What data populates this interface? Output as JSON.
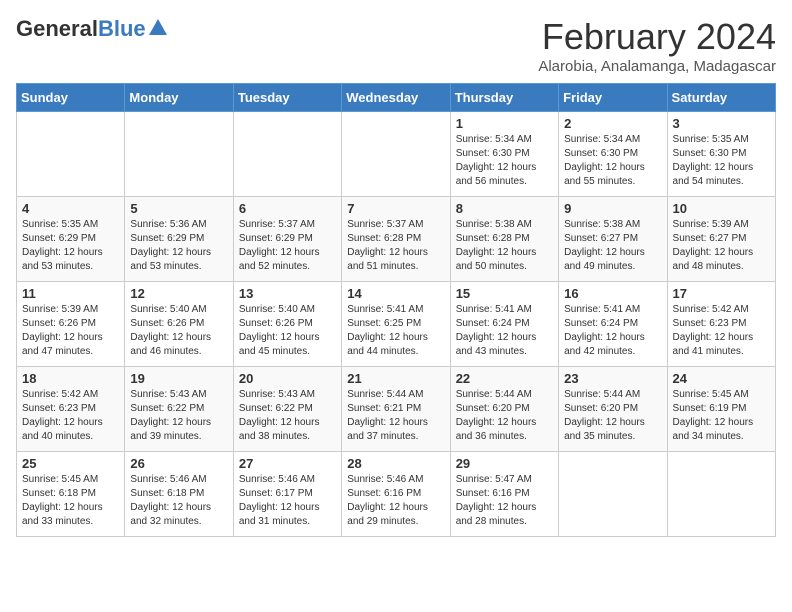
{
  "header": {
    "logo_general": "General",
    "logo_blue": "Blue",
    "month_title": "February 2024",
    "location": "Alarobia, Analamanga, Madagascar"
  },
  "weekdays": [
    "Sunday",
    "Monday",
    "Tuesday",
    "Wednesday",
    "Thursday",
    "Friday",
    "Saturday"
  ],
  "weeks": [
    [
      {
        "num": "",
        "info": ""
      },
      {
        "num": "",
        "info": ""
      },
      {
        "num": "",
        "info": ""
      },
      {
        "num": "",
        "info": ""
      },
      {
        "num": "1",
        "info": "Sunrise: 5:34 AM\nSunset: 6:30 PM\nDaylight: 12 hours\nand 56 minutes."
      },
      {
        "num": "2",
        "info": "Sunrise: 5:34 AM\nSunset: 6:30 PM\nDaylight: 12 hours\nand 55 minutes."
      },
      {
        "num": "3",
        "info": "Sunrise: 5:35 AM\nSunset: 6:30 PM\nDaylight: 12 hours\nand 54 minutes."
      }
    ],
    [
      {
        "num": "4",
        "info": "Sunrise: 5:35 AM\nSunset: 6:29 PM\nDaylight: 12 hours\nand 53 minutes."
      },
      {
        "num": "5",
        "info": "Sunrise: 5:36 AM\nSunset: 6:29 PM\nDaylight: 12 hours\nand 53 minutes."
      },
      {
        "num": "6",
        "info": "Sunrise: 5:37 AM\nSunset: 6:29 PM\nDaylight: 12 hours\nand 52 minutes."
      },
      {
        "num": "7",
        "info": "Sunrise: 5:37 AM\nSunset: 6:28 PM\nDaylight: 12 hours\nand 51 minutes."
      },
      {
        "num": "8",
        "info": "Sunrise: 5:38 AM\nSunset: 6:28 PM\nDaylight: 12 hours\nand 50 minutes."
      },
      {
        "num": "9",
        "info": "Sunrise: 5:38 AM\nSunset: 6:27 PM\nDaylight: 12 hours\nand 49 minutes."
      },
      {
        "num": "10",
        "info": "Sunrise: 5:39 AM\nSunset: 6:27 PM\nDaylight: 12 hours\nand 48 minutes."
      }
    ],
    [
      {
        "num": "11",
        "info": "Sunrise: 5:39 AM\nSunset: 6:26 PM\nDaylight: 12 hours\nand 47 minutes."
      },
      {
        "num": "12",
        "info": "Sunrise: 5:40 AM\nSunset: 6:26 PM\nDaylight: 12 hours\nand 46 minutes."
      },
      {
        "num": "13",
        "info": "Sunrise: 5:40 AM\nSunset: 6:26 PM\nDaylight: 12 hours\nand 45 minutes."
      },
      {
        "num": "14",
        "info": "Sunrise: 5:41 AM\nSunset: 6:25 PM\nDaylight: 12 hours\nand 44 minutes."
      },
      {
        "num": "15",
        "info": "Sunrise: 5:41 AM\nSunset: 6:24 PM\nDaylight: 12 hours\nand 43 minutes."
      },
      {
        "num": "16",
        "info": "Sunrise: 5:41 AM\nSunset: 6:24 PM\nDaylight: 12 hours\nand 42 minutes."
      },
      {
        "num": "17",
        "info": "Sunrise: 5:42 AM\nSunset: 6:23 PM\nDaylight: 12 hours\nand 41 minutes."
      }
    ],
    [
      {
        "num": "18",
        "info": "Sunrise: 5:42 AM\nSunset: 6:23 PM\nDaylight: 12 hours\nand 40 minutes."
      },
      {
        "num": "19",
        "info": "Sunrise: 5:43 AM\nSunset: 6:22 PM\nDaylight: 12 hours\nand 39 minutes."
      },
      {
        "num": "20",
        "info": "Sunrise: 5:43 AM\nSunset: 6:22 PM\nDaylight: 12 hours\nand 38 minutes."
      },
      {
        "num": "21",
        "info": "Sunrise: 5:44 AM\nSunset: 6:21 PM\nDaylight: 12 hours\nand 37 minutes."
      },
      {
        "num": "22",
        "info": "Sunrise: 5:44 AM\nSunset: 6:20 PM\nDaylight: 12 hours\nand 36 minutes."
      },
      {
        "num": "23",
        "info": "Sunrise: 5:44 AM\nSunset: 6:20 PM\nDaylight: 12 hours\nand 35 minutes."
      },
      {
        "num": "24",
        "info": "Sunrise: 5:45 AM\nSunset: 6:19 PM\nDaylight: 12 hours\nand 34 minutes."
      }
    ],
    [
      {
        "num": "25",
        "info": "Sunrise: 5:45 AM\nSunset: 6:18 PM\nDaylight: 12 hours\nand 33 minutes."
      },
      {
        "num": "26",
        "info": "Sunrise: 5:46 AM\nSunset: 6:18 PM\nDaylight: 12 hours\nand 32 minutes."
      },
      {
        "num": "27",
        "info": "Sunrise: 5:46 AM\nSunset: 6:17 PM\nDaylight: 12 hours\nand 31 minutes."
      },
      {
        "num": "28",
        "info": "Sunrise: 5:46 AM\nSunset: 6:16 PM\nDaylight: 12 hours\nand 29 minutes."
      },
      {
        "num": "29",
        "info": "Sunrise: 5:47 AM\nSunset: 6:16 PM\nDaylight: 12 hours\nand 28 minutes."
      },
      {
        "num": "",
        "info": ""
      },
      {
        "num": "",
        "info": ""
      }
    ]
  ]
}
